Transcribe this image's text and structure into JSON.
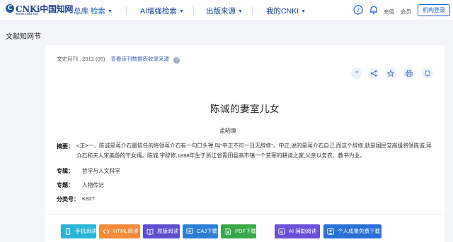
{
  "nav": {
    "logo_main": "CNKi中国知网",
    "logo_url": "www.cnki.net",
    "item1": "总库",
    "item1_sub": "检索",
    "item2": "AI增强检索",
    "item3": "出版来源",
    "item4": "我的CNKI",
    "recharge": "充值",
    "member": "会员",
    "login": "机构登录"
  },
  "breadcrumb": {
    "title": "文献知网节"
  },
  "article": {
    "source_prefix": "文史月刊 , 2012 (05)",
    "journal_link": "查看该刊数据库收录来源",
    "help": "?",
    "title": "陈诚的妻室儿女",
    "author": "孟昭庚",
    "abstract_label": "摘要：",
    "abstract": "<正>一、陈诚是蒋介石最信任的将领蒋介石有一句口头禅,叫\"中正不可一日无辞修\"。中正,说的是蒋介石自己,而这个辞修,就是国民党高级将领陈诚,蒋介石和夫人宋美龄的干女婿。陈诚,字辞修,1898年生于浙江省青田县高市镇一个贫寒的耕读之家,父亲以务农、教书为业。",
    "fields": [
      {
        "label": "专辑：",
        "value": "哲学与人文科学"
      },
      {
        "label": "专题：",
        "value": "人物传记"
      },
      {
        "label": "分类号：",
        "value": "K827"
      }
    ]
  },
  "buttons": [
    {
      "label": "手机阅读",
      "color": "#29b5d8"
    },
    {
      "label": "HTML阅读",
      "color": "#f28b3a"
    },
    {
      "label": "原版阅读",
      "color": "#5d4fcf"
    },
    {
      "label": "CAJ下载",
      "color": "#2d7fd6"
    },
    {
      "label": "PDF下载",
      "color": "#3aa84a"
    },
    {
      "label": "AI 辅助阅读",
      "color": "#6a4fd8"
    },
    {
      "label": "个人成果免费下载",
      "color": "#2a6fd6"
    }
  ],
  "icons": [
    "logo-mark",
    "chevron-down-icon",
    "help-icon",
    "bell-icon",
    "quote-icon",
    "share-icon",
    "star-icon",
    "print-icon",
    "notify-icon",
    "mobile-icon",
    "code-icon",
    "book-icon",
    "download-icon",
    "pdf-icon",
    "ai-icon",
    "person-icon"
  ]
}
